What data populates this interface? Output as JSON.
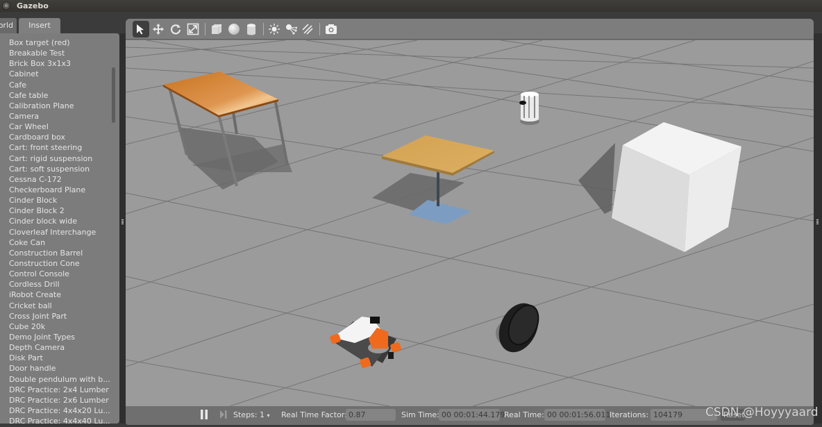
{
  "window": {
    "title": "Gazebo"
  },
  "tabs": [
    {
      "label": "World",
      "visible_text": "orld",
      "active": false
    },
    {
      "label": "Insert",
      "active": true
    }
  ],
  "insert_panel": {
    "items": [
      "Box target (red)",
      "Breakable Test",
      "Brick Box 3x1x3",
      "Cabinet",
      "Cafe",
      "Cafe table",
      "Calibration Plane",
      "Camera",
      "Car Wheel",
      "Cardboard box",
      "Cart: front steering",
      "Cart: rigid suspension",
      "Cart: soft suspension",
      "Cessna C-172",
      "Checkerboard Plane",
      "Cinder Block",
      "Cinder Block 2",
      "Cinder block wide",
      "Cloverleaf Interchange",
      "Coke Can",
      "Construction Barrel",
      "Construction Cone",
      "Control Console",
      "Cordless Drill",
      "iRobot Create",
      "Cricket ball",
      "Cross Joint Part",
      "Cube 20k",
      "Demo Joint Types",
      "Depth Camera",
      "Disk Part",
      "Door handle",
      "Double pendulum with b...",
      "DRC Practice: 2x4 Lumber",
      "DRC Practice: 2x6 Lumber",
      "DRC Practice: 4x4x20 Lu...",
      "DRC Practice: 4x4x40 Lu..."
    ]
  },
  "toolbar": {
    "tools": [
      {
        "name": "select-mode",
        "icon": "arrow-cursor-icon",
        "active": true
      },
      {
        "name": "translate-mode",
        "icon": "move-arrows-icon",
        "active": false
      },
      {
        "name": "rotate-mode",
        "icon": "rotate-icon",
        "active": false
      },
      {
        "name": "scale-mode",
        "icon": "scale-icon",
        "active": false
      },
      {
        "name": "box-shape",
        "icon": "box-icon"
      },
      {
        "name": "sphere-shape",
        "icon": "sphere-icon"
      },
      {
        "name": "cylinder-shape",
        "icon": "cylinder-icon"
      },
      {
        "name": "point-light",
        "icon": "point-light-icon"
      },
      {
        "name": "spot-light",
        "icon": "spot-light-icon"
      },
      {
        "name": "directional-light",
        "icon": "directional-light-icon"
      },
      {
        "name": "screenshot",
        "icon": "camera-icon"
      }
    ]
  },
  "scene": {
    "models": [
      "table",
      "cafe table",
      "turtlebot",
      "cube",
      "mobile manipulator robot",
      "car wheel"
    ],
    "colors": {
      "ground": "#9b9b9b",
      "grid_line": "#6e6e6e",
      "table_top": "#d88a3a",
      "cafe_table_top": "#d9a656",
      "cafe_base": "#7a9cc0",
      "robot_orange": "#f06a1e",
      "cube": "#e8e8e8"
    }
  },
  "statusbar": {
    "pause_icon": "pause-icon",
    "step_icon": "step-forward-icon",
    "steps_label": "Steps:",
    "steps_value": "1",
    "rtf_label": "Real Time Factor:",
    "rtf_value": "0.87",
    "sim_time_label": "Sim Time:",
    "sim_time_value": "00 00:01:44.179",
    "real_time_label": "Real Time:",
    "real_time_value": "00 00:01:56.011",
    "iterations_label": "Iterations:",
    "iterations_value": "104179",
    "reset_label": "Reset"
  },
  "watermark": "CSDN @Hoyyyaard"
}
